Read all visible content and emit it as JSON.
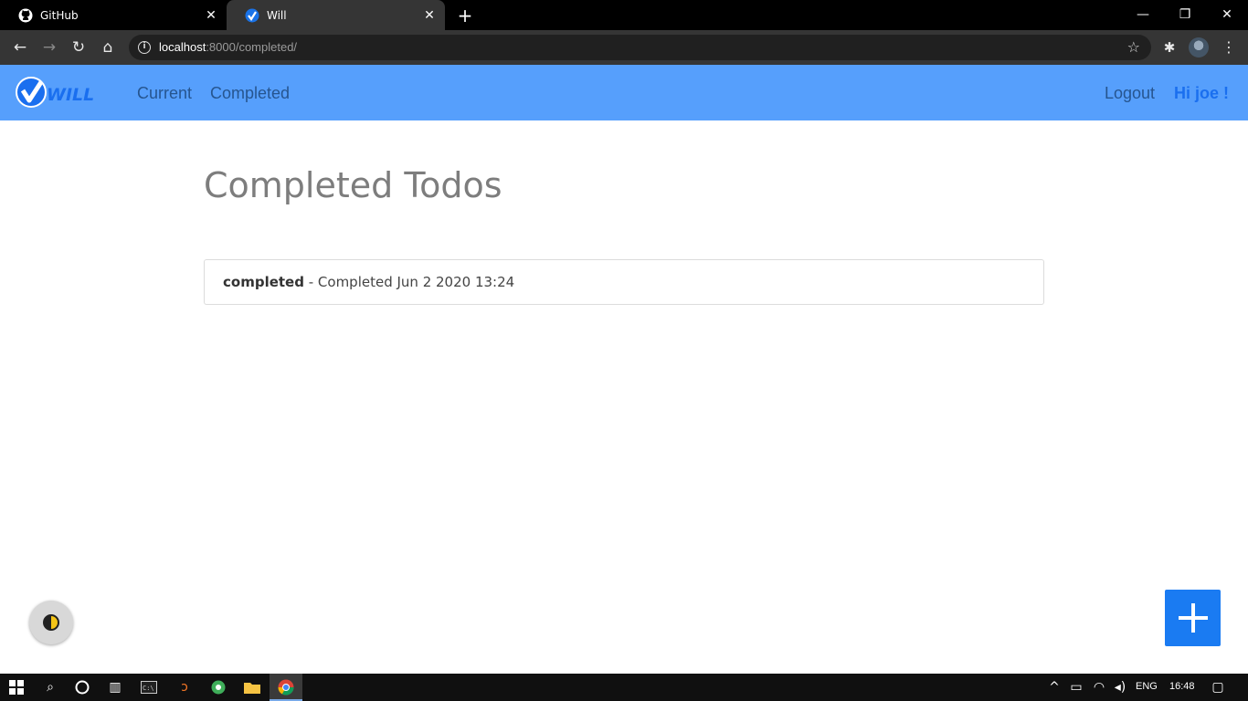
{
  "browser": {
    "tabs": [
      {
        "title": "GitHub",
        "icon": "github-icon",
        "active": false
      },
      {
        "title": "Will",
        "icon": "will-check-icon",
        "active": true
      }
    ],
    "url_host": "localhost",
    "url_rest": ":8000/completed/"
  },
  "site": {
    "logo_text": "WILL",
    "nav": {
      "current": "Current",
      "completed": "Completed",
      "logout": "Logout",
      "greeting": "Hi joe !"
    },
    "colors": {
      "navbar_bg": "#569ffc",
      "link": "#26558f",
      "greeting": "#1a6fef",
      "fab": "#1a7bf2"
    }
  },
  "main": {
    "title": "Completed Todos",
    "todos": [
      {
        "name": "completed",
        "detail": " - Completed Jun 2 2020 13:24"
      }
    ]
  },
  "taskbar": {
    "language": "ENG",
    "time": "16:48"
  }
}
